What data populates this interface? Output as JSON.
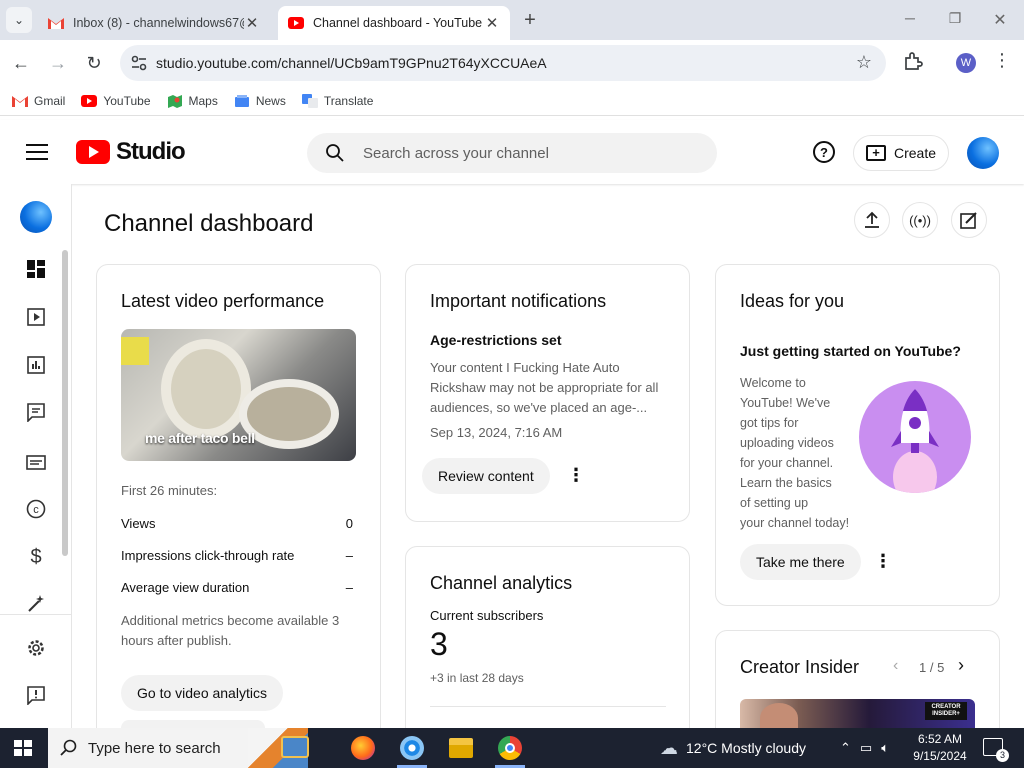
{
  "browser": {
    "tabs": [
      {
        "title": "Inbox (8) - channelwindows67@",
        "active": false
      },
      {
        "title": "Channel dashboard - YouTube",
        "active": true
      }
    ],
    "url": "studio.youtube.com/channel/UCb9amT9GPnu2T64yXCCUAeA",
    "profile_initial": "W",
    "bookmarks": [
      "Gmail",
      "YouTube",
      "Maps",
      "News",
      "Translate"
    ]
  },
  "header": {
    "logo_text": "Studio",
    "search_placeholder": "Search across your channel",
    "create_label": "Create"
  },
  "page": {
    "title": "Channel dashboard"
  },
  "latest_video": {
    "title": "Latest video performance",
    "thumbnail_caption": "me after taco bell",
    "period": "First 26 minutes:",
    "stats": [
      {
        "label": "Views",
        "value": "0"
      },
      {
        "label": "Impressions click-through rate",
        "value": "–"
      },
      {
        "label": "Average view duration",
        "value": "–"
      }
    ],
    "note": "Additional metrics become available 3 hours after publish.",
    "button": "Go to video analytics"
  },
  "notifications": {
    "title": "Important notifications",
    "subtitle": "Age-restrictions set",
    "body": "Your content I Fucking Hate Auto Rickshaw may not be appropriate for all audiences, so we've placed an age-...",
    "date": "Sep 13, 2024, 7:16 AM",
    "button": "Review content"
  },
  "analytics": {
    "title": "Channel analytics",
    "subs_label": "Current subscribers",
    "subs_value": "3",
    "subs_delta": "+3 in last 28 days"
  },
  "ideas": {
    "title": "Ideas for you",
    "subtitle": "Just getting started on YouTube?",
    "body_lines": [
      "Welcome to",
      "YouTube! We've",
      "got tips for",
      "uploading videos",
      "for your channel.",
      "Learn the basics",
      "of setting up",
      "your channel today!"
    ],
    "button": "Take me there"
  },
  "creator_insider": {
    "title": "Creator Insider",
    "pager": "1 / 5",
    "thumb_text": "CREATOR INSIDER+"
  },
  "taskbar": {
    "search_placeholder": "Type here to search",
    "weather": "12°C  Mostly cloudy",
    "time": "6:52 AM",
    "date": "9/15/2024",
    "notif_count": "3"
  },
  "colors": {
    "youtube_red": "#ff0000",
    "taskbar": "#1c2230",
    "idea_circle": "#c98ef0"
  }
}
